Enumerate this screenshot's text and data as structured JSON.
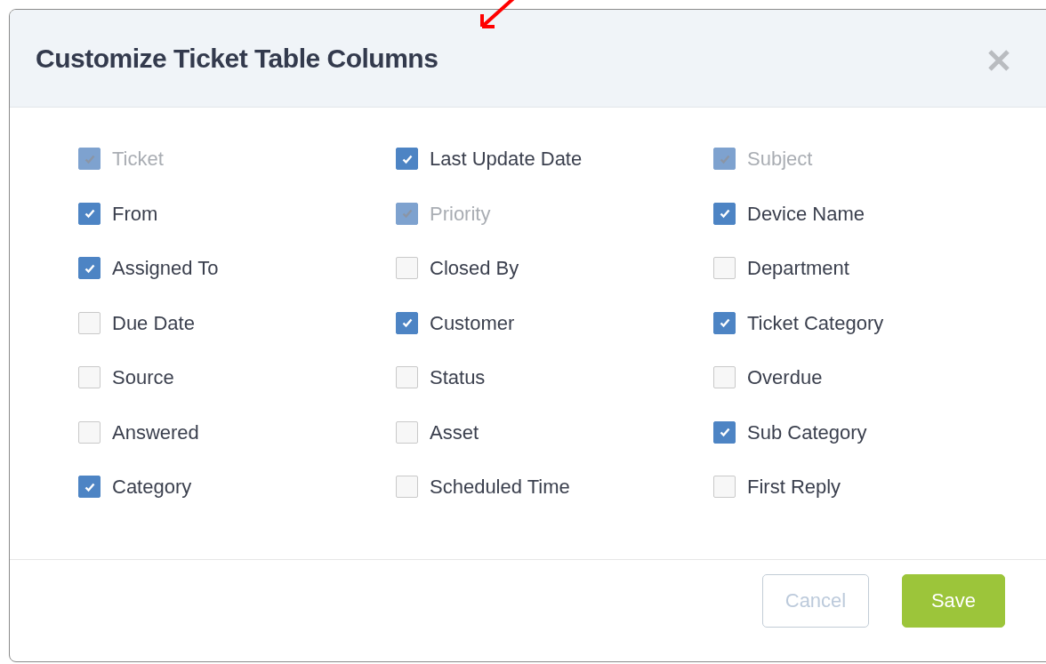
{
  "dialog": {
    "title": "Customize Ticket Table Columns"
  },
  "columns": [
    {
      "label": "Ticket",
      "checked": true,
      "disabled": true
    },
    {
      "label": "Last Update Date",
      "checked": true,
      "disabled": false
    },
    {
      "label": "Subject",
      "checked": true,
      "disabled": true
    },
    {
      "label": "From",
      "checked": true,
      "disabled": false
    },
    {
      "label": "Priority",
      "checked": true,
      "disabled": true
    },
    {
      "label": "Device Name",
      "checked": true,
      "disabled": false
    },
    {
      "label": "Assigned To",
      "checked": true,
      "disabled": false
    },
    {
      "label": "Closed By",
      "checked": false,
      "disabled": false
    },
    {
      "label": "Department",
      "checked": false,
      "disabled": false
    },
    {
      "label": "Due Date",
      "checked": false,
      "disabled": false
    },
    {
      "label": "Customer",
      "checked": true,
      "disabled": false
    },
    {
      "label": "Ticket Category",
      "checked": true,
      "disabled": false
    },
    {
      "label": "Source",
      "checked": false,
      "disabled": false
    },
    {
      "label": "Status",
      "checked": false,
      "disabled": false
    },
    {
      "label": "Overdue",
      "checked": false,
      "disabled": false
    },
    {
      "label": "Answered",
      "checked": false,
      "disabled": false
    },
    {
      "label": "Asset",
      "checked": false,
      "disabled": false
    },
    {
      "label": "Sub Category",
      "checked": true,
      "disabled": false
    },
    {
      "label": "Category",
      "checked": true,
      "disabled": false
    },
    {
      "label": "Scheduled Time",
      "checked": false,
      "disabled": false
    },
    {
      "label": "First Reply",
      "checked": false,
      "disabled": false
    }
  ],
  "buttons": [
    {
      "label": "Cancel",
      "kind": "secondary",
      "disabled": true
    },
    {
      "label": "Save",
      "kind": "primary",
      "disabled": false
    }
  ]
}
